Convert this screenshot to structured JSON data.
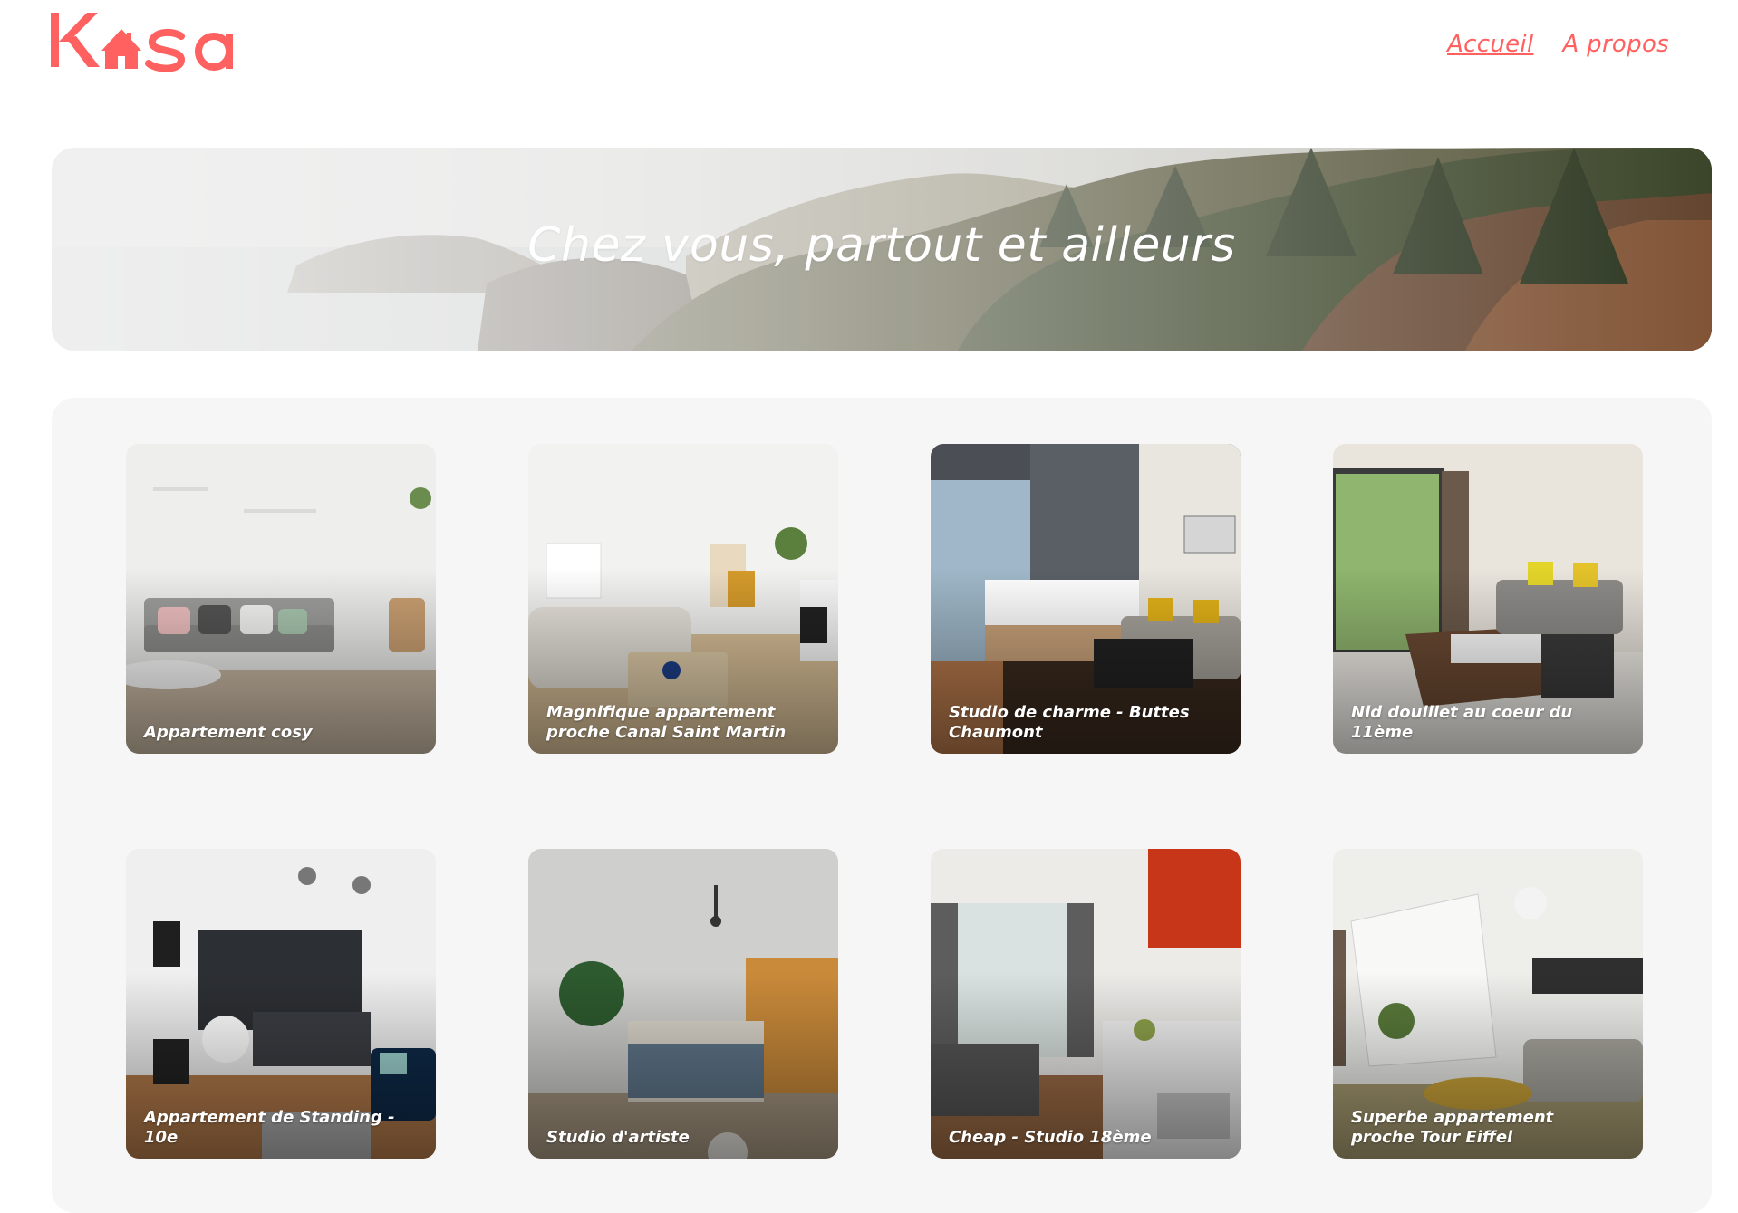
{
  "brand": {
    "logo_text": "Kasa",
    "accent_color": "#FF6060"
  },
  "nav": {
    "items": [
      {
        "label": "Accueil",
        "active": true
      },
      {
        "label": "A propos",
        "active": false
      }
    ]
  },
  "banner": {
    "title": "Chez vous, partout et ailleurs"
  },
  "listings": [
    {
      "title": "Appartement cosy"
    },
    {
      "title": "Magnifique appartement proche Canal Saint Martin"
    },
    {
      "title": "Studio de charme - Buttes Chaumont"
    },
    {
      "title": "Nid douillet au coeur du 11ème"
    },
    {
      "title": "Appartement de Standing - 10e"
    },
    {
      "title": "Studio d'artiste"
    },
    {
      "title": "Cheap - Studio 18ème"
    },
    {
      "title": "Superbe appartement proche Tour Eiffel"
    }
  ]
}
